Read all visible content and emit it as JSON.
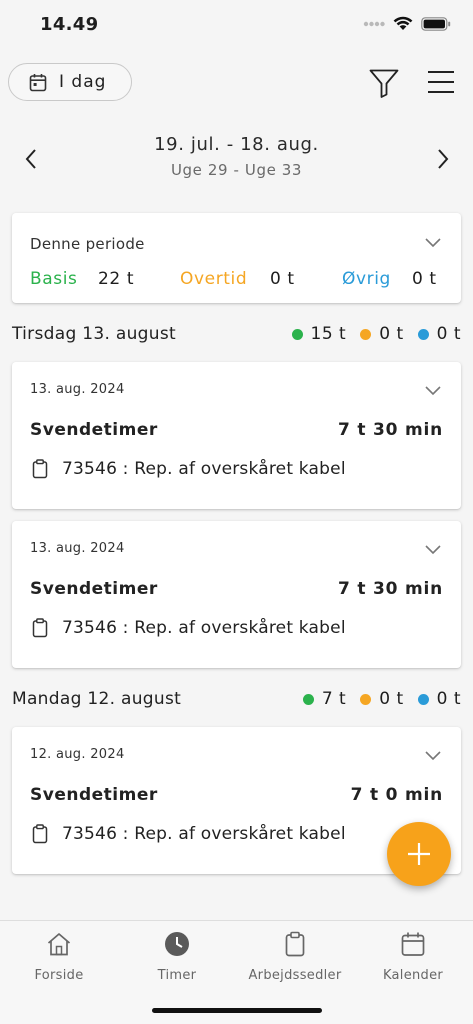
{
  "status_bar": {
    "time": "14.49"
  },
  "top_bar": {
    "today_label": "I dag"
  },
  "period": {
    "dates": "19. jul.  -  18. aug.",
    "weeks": "Uge 29  -  Uge 33"
  },
  "summary": {
    "title": "Denne periode",
    "basis_label": "Basis",
    "basis_value": "22 t",
    "overtid_label": "Overtid",
    "overtid_value": "0 t",
    "ovrig_label": "Øvrig",
    "ovrig_value": "0 t"
  },
  "days": [
    {
      "title": "Tirsdag 13. august",
      "totals": [
        "15 t",
        "0 t",
        "0 t"
      ],
      "entries": [
        {
          "date": "13. aug. 2024",
          "type": "Svendetimer",
          "hours": "7 t 30 min",
          "job": "73546 : Rep. af overskåret kabel"
        },
        {
          "date": "13. aug. 2024",
          "type": "Svendetimer",
          "hours": "7 t 30 min",
          "job": "73546 : Rep. af overskåret kabel"
        }
      ]
    },
    {
      "title": "Mandag 12. august",
      "totals": [
        "7 t",
        "0 t",
        "0 t"
      ],
      "entries": [
        {
          "date": "12. aug. 2024",
          "type": "Svendetimer",
          "hours": "7 t 0 min",
          "job": "73546 : Rep. af overskåret kabel"
        }
      ]
    }
  ],
  "colors": {
    "basis": "#2bb24c",
    "overtid": "#f5a623",
    "ovrig": "#2a9bd8",
    "fab": "#f7a21a"
  },
  "bottom_nav": [
    {
      "label": "Forside",
      "icon": "home-icon"
    },
    {
      "label": "Timer",
      "icon": "clock-icon"
    },
    {
      "label": "Arbejdssedler",
      "icon": "clipboard-icon"
    },
    {
      "label": "Kalender",
      "icon": "calendar-icon"
    }
  ]
}
